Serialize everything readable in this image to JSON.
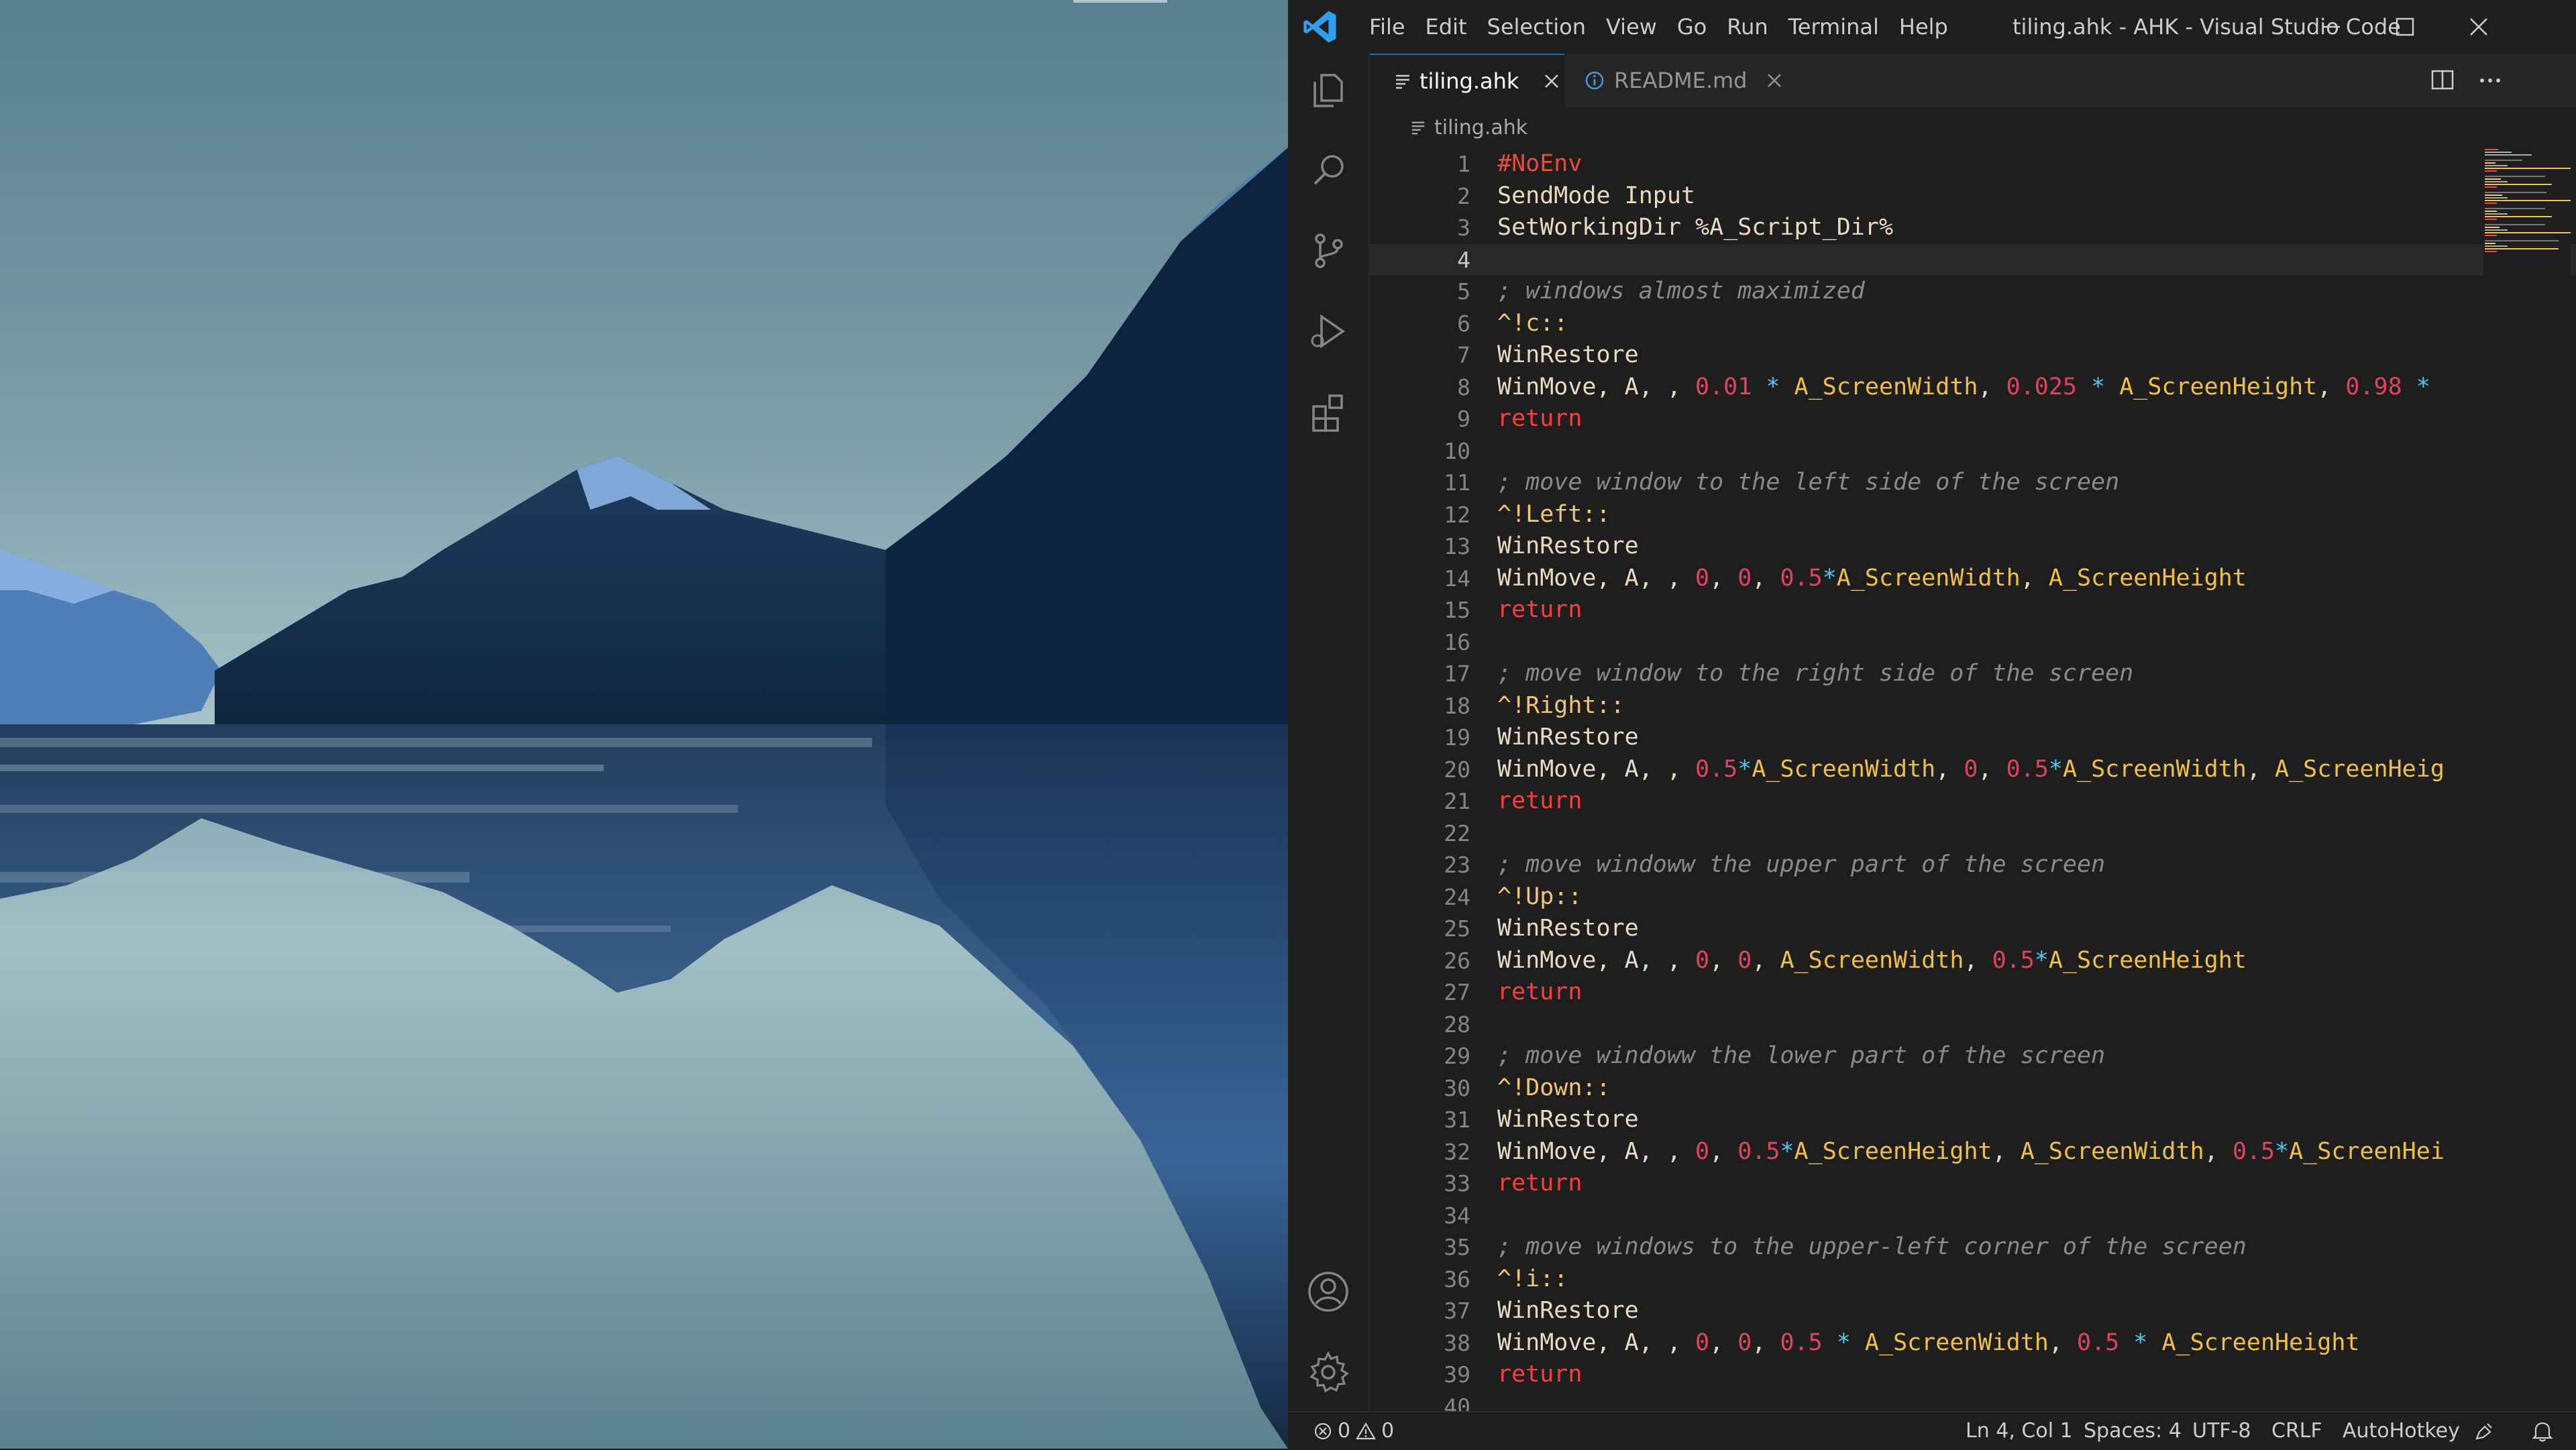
{
  "app": {
    "window_title": "tiling.ahk - AHK - Visual Studio Code",
    "menu": [
      "File",
      "Edit",
      "Selection",
      "View",
      "Go",
      "Run",
      "Terminal",
      "Help"
    ]
  },
  "activity_bar": {
    "icons": [
      "explorer-icon",
      "search-icon",
      "source-control-icon",
      "run-debug-icon",
      "extensions-icon",
      "account-icon",
      "settings-gear-icon"
    ]
  },
  "tabs": [
    {
      "label": "tiling.ahk",
      "active": true,
      "icon": "lines-icon"
    },
    {
      "label": "README.md",
      "active": false,
      "icon": "info-icon"
    }
  ],
  "breadcrumb": {
    "file": "tiling.ahk"
  },
  "editor": {
    "current_line": 4,
    "lines": [
      [
        [
          "c-directive",
          "#NoEnv"
        ]
      ],
      [
        [
          "c-cmd",
          "SendMode Input"
        ]
      ],
      [
        [
          "c-cmd",
          "SetWorkingDir %A_Script_Dir%"
        ]
      ],
      [],
      [
        [
          "c-comment",
          "; windows almost maximized"
        ]
      ],
      [
        [
          "c-hotkey",
          "^!c::"
        ]
      ],
      [
        [
          "c-cmd",
          "WinRestore"
        ]
      ],
      [
        [
          "c-cmd",
          "WinMove, A, , "
        ],
        [
          "c-num",
          "0.01"
        ],
        [
          "c-op",
          " * "
        ],
        [
          "c-var",
          "A_ScreenWidth"
        ],
        [
          "c-plain",
          ", "
        ],
        [
          "c-num",
          "0.025"
        ],
        [
          "c-op",
          " * "
        ],
        [
          "c-var",
          "A_ScreenHeight"
        ],
        [
          "c-plain",
          ", "
        ],
        [
          "c-num",
          "0.98"
        ],
        [
          "c-op",
          " * "
        ]
      ],
      [
        [
          "c-ret",
          "return"
        ]
      ],
      [],
      [
        [
          "c-comment",
          "; move window to the left side of the screen"
        ]
      ],
      [
        [
          "c-hotkey",
          "^!Left::"
        ]
      ],
      [
        [
          "c-cmd",
          "WinRestore"
        ]
      ],
      [
        [
          "c-cmd",
          "WinMove, A, , "
        ],
        [
          "c-num",
          "0"
        ],
        [
          "c-plain",
          ", "
        ],
        [
          "c-num",
          "0"
        ],
        [
          "c-plain",
          ", "
        ],
        [
          "c-num",
          "0.5"
        ],
        [
          "c-op",
          "*"
        ],
        [
          "c-var",
          "A_ScreenWidth"
        ],
        [
          "c-plain",
          ", "
        ],
        [
          "c-var",
          "A_ScreenHeight"
        ]
      ],
      [
        [
          "c-ret",
          "return"
        ]
      ],
      [],
      [
        [
          "c-comment",
          "; move window to the right side of the screen"
        ]
      ],
      [
        [
          "c-hotkey",
          "^!Right::"
        ]
      ],
      [
        [
          "c-cmd",
          "WinRestore"
        ]
      ],
      [
        [
          "c-cmd",
          "WinMove, A, , "
        ],
        [
          "c-num",
          "0.5"
        ],
        [
          "c-op",
          "*"
        ],
        [
          "c-var",
          "A_ScreenWidth"
        ],
        [
          "c-plain",
          ", "
        ],
        [
          "c-num",
          "0"
        ],
        [
          "c-plain",
          ", "
        ],
        [
          "c-num",
          "0.5"
        ],
        [
          "c-op",
          "*"
        ],
        [
          "c-var",
          "A_ScreenWidth"
        ],
        [
          "c-plain",
          ", "
        ],
        [
          "c-var",
          "A_ScreenHeig"
        ]
      ],
      [
        [
          "c-ret",
          "return"
        ]
      ],
      [],
      [
        [
          "c-comment",
          "; move windoww the upper part of the screen"
        ]
      ],
      [
        [
          "c-hotkey",
          "^!Up::"
        ]
      ],
      [
        [
          "c-cmd",
          "WinRestore"
        ]
      ],
      [
        [
          "c-cmd",
          "WinMove, A, , "
        ],
        [
          "c-num",
          "0"
        ],
        [
          "c-plain",
          ", "
        ],
        [
          "c-num",
          "0"
        ],
        [
          "c-plain",
          ", "
        ],
        [
          "c-var",
          "A_ScreenWidth"
        ],
        [
          "c-plain",
          ", "
        ],
        [
          "c-num",
          "0.5"
        ],
        [
          "c-op",
          "*"
        ],
        [
          "c-var",
          "A_ScreenHeight"
        ]
      ],
      [
        [
          "c-ret",
          "return"
        ]
      ],
      [],
      [
        [
          "c-comment",
          "; move windoww the lower part of the screen"
        ]
      ],
      [
        [
          "c-hotkey",
          "^!Down::"
        ]
      ],
      [
        [
          "c-cmd",
          "WinRestore"
        ]
      ],
      [
        [
          "c-cmd",
          "WinMove, A, , "
        ],
        [
          "c-num",
          "0"
        ],
        [
          "c-plain",
          ", "
        ],
        [
          "c-num",
          "0.5"
        ],
        [
          "c-op",
          "*"
        ],
        [
          "c-var",
          "A_ScreenHeight"
        ],
        [
          "c-plain",
          ", "
        ],
        [
          "c-var",
          "A_ScreenWidth"
        ],
        [
          "c-plain",
          ", "
        ],
        [
          "c-num",
          "0.5"
        ],
        [
          "c-op",
          "*"
        ],
        [
          "c-var",
          "A_ScreenHei"
        ]
      ],
      [
        [
          "c-ret",
          "return"
        ]
      ],
      [],
      [
        [
          "c-comment",
          "; move windows to the upper-left corner of the screen"
        ]
      ],
      [
        [
          "c-hotkey",
          "^!i::"
        ]
      ],
      [
        [
          "c-cmd",
          "WinRestore"
        ]
      ],
      [
        [
          "c-cmd",
          "WinMove, A, , "
        ],
        [
          "c-num",
          "0"
        ],
        [
          "c-plain",
          ", "
        ],
        [
          "c-num",
          "0"
        ],
        [
          "c-plain",
          ", "
        ],
        [
          "c-num",
          "0.5"
        ],
        [
          "c-op",
          " * "
        ],
        [
          "c-var",
          "A_ScreenWidth"
        ],
        [
          "c-plain",
          ", "
        ],
        [
          "c-num",
          "0.5"
        ],
        [
          "c-op",
          " * "
        ],
        [
          "c-var",
          "A_ScreenHeight"
        ]
      ],
      [
        [
          "c-ret",
          "return"
        ]
      ],
      []
    ]
  },
  "status_bar": {
    "errors": "0",
    "warnings": "0",
    "position": "Ln 4, Col 1",
    "spaces": "Spaces: 4",
    "encoding": "UTF-8",
    "eol": "CRLF",
    "language": "AutoHotkey"
  },
  "colors": {
    "accent": "#0e70c0",
    "editor_bg": "#1e1e1e",
    "comment": "#8a8a8a",
    "keyword_return": "#ff3c3c",
    "variable": "#f0c040",
    "number": "#e0445c"
  }
}
